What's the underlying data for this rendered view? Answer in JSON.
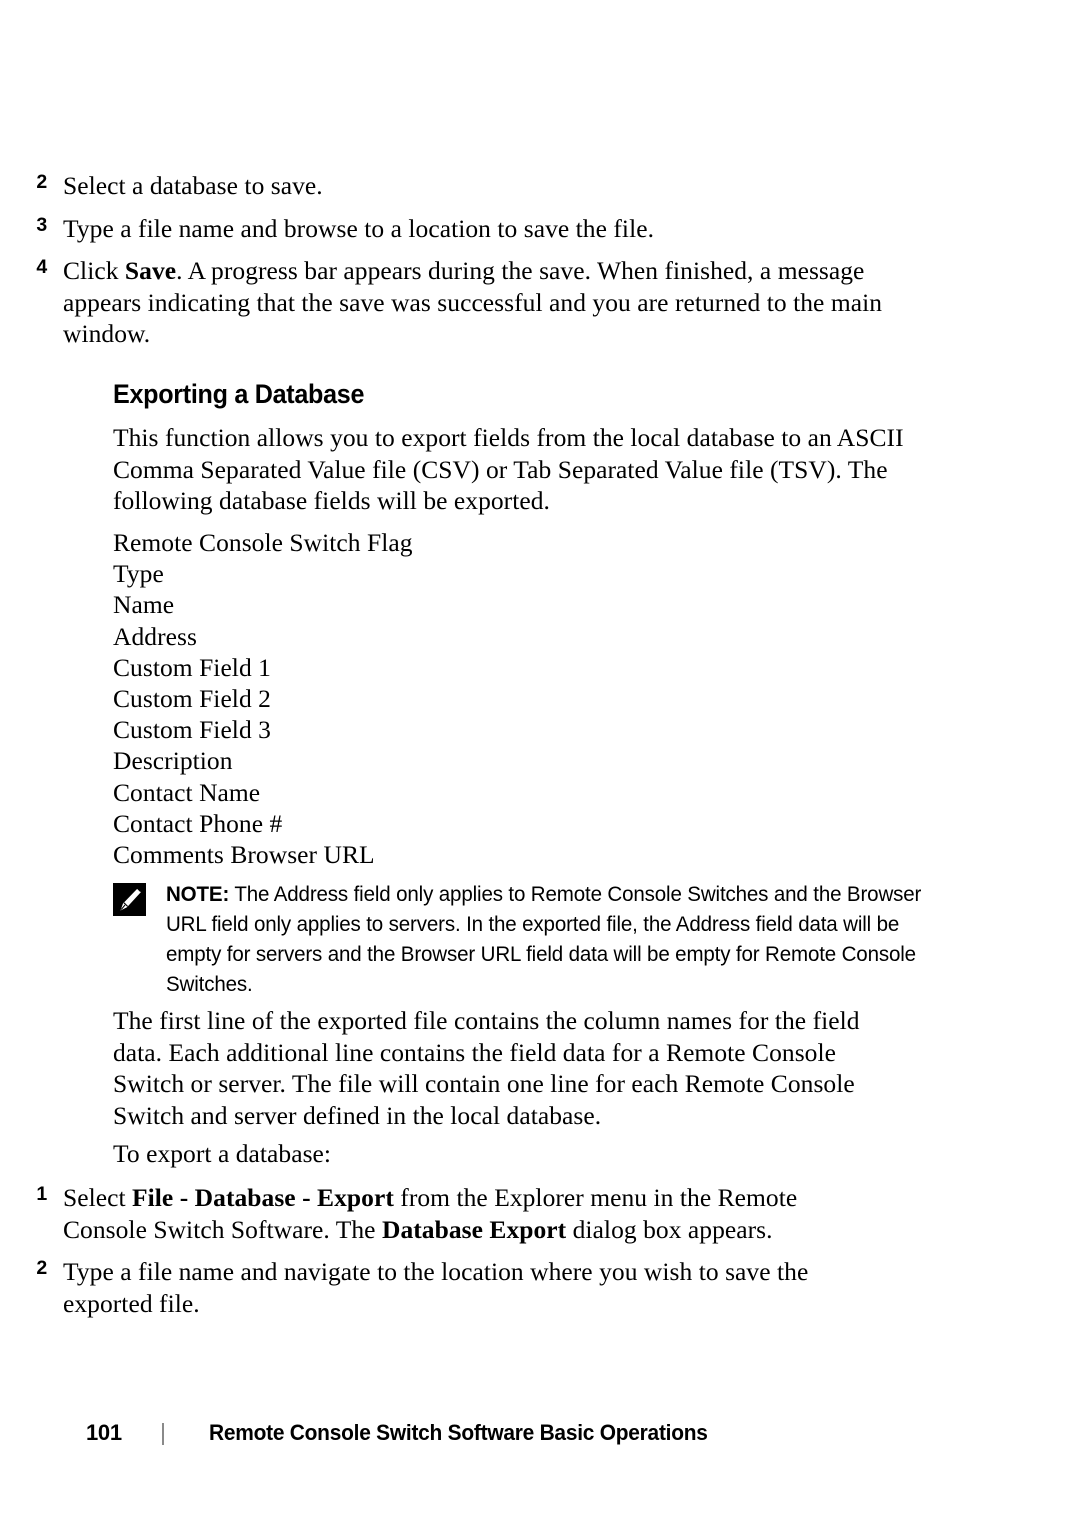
{
  "document": {
    "page_number": "101",
    "footer_title": "Remote Console Switch Software Basic Operations"
  },
  "save_steps": [
    {
      "number": "2",
      "text": "Select a database to save."
    },
    {
      "number": "3",
      "text": "Type a file name and browse to a location to save the file."
    },
    {
      "number": "4",
      "text_before": "Click ",
      "bold": "Save",
      "text_after": ". A progress bar appears during the save. When finished, a message appears indicating that the save was successful and you are returned to the main window."
    }
  ],
  "section": {
    "heading": "Exporting a Database",
    "intro": "This function allows you to export fields from the local database to an ASCII Comma Separated Value file (CSV) or Tab Separated Value file (TSV). The following database fields will be exported."
  },
  "exported_fields": [
    "Remote Console Switch Flag",
    "Type",
    "Name",
    "Address",
    "Custom Field 1",
    "Custom Field 2",
    "Custom Field 3",
    "Description",
    "Contact Name",
    "Contact Phone #",
    "Comments Browser URL"
  ],
  "note": {
    "icon": "note-pencil-icon",
    "label": "NOTE:",
    "text": " The Address field only applies to Remote Console Switches and the Browser URL field only applies to servers. In the exported file, the Address field data will be empty for servers and the Browser URL field data will be empty for Remote Console Switches."
  },
  "after_note_paragraph": "The first line of the exported file contains the column names for the field data. Each additional line contains the field data for a Remote Console Switch or server. The file will contain one line for each Remote Console Switch and server defined in the local database.",
  "export_lead_in": "To export a database:",
  "export_steps": [
    {
      "number": "1",
      "text_before": "Select ",
      "bold": "File - Database - Export",
      "text_mid": " from the Explorer menu in the Remote Console Switch Software. The ",
      "bold2": "Database Export",
      "text_after": " dialog box appears."
    },
    {
      "number": "2",
      "text": "Type a file name and navigate to the location where you wish to save the exported file."
    }
  ]
}
